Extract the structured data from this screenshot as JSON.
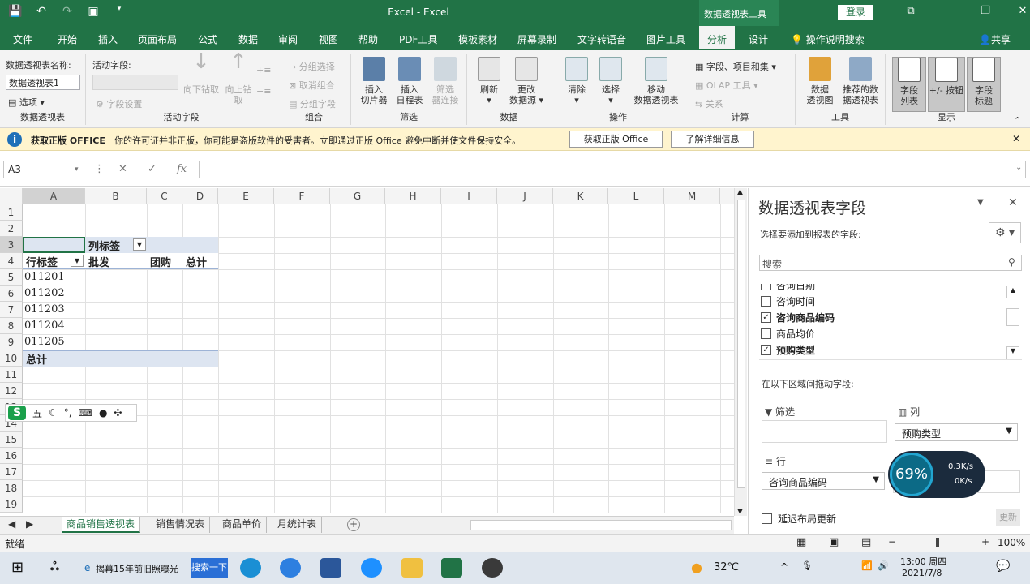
{
  "window": {
    "title": "Excel - Excel",
    "context_tools": "数据透视表工具",
    "login": "登录"
  },
  "icons": {
    "save": "save-icon",
    "undo": "undo-icon",
    "redo": "redo-icon",
    "touch": "touch-mode-icon",
    "customize": "chevron-down-icon"
  },
  "tabs": [
    {
      "label": "文件"
    },
    {
      "label": "开始"
    },
    {
      "label": "插入"
    },
    {
      "label": "页面布局"
    },
    {
      "label": "公式"
    },
    {
      "label": "数据"
    },
    {
      "label": "审阅"
    },
    {
      "label": "视图"
    },
    {
      "label": "帮助"
    },
    {
      "label": "PDF工具"
    },
    {
      "label": "模板素材"
    },
    {
      "label": "屏幕录制"
    },
    {
      "label": "文字转语音"
    },
    {
      "label": "图片工具"
    },
    {
      "label": "分析"
    },
    {
      "label": "设计"
    }
  ],
  "tellme": "操作说明搜索",
  "share": "共享",
  "ribbon": {
    "pivot_name_label": "数据透视表名称:",
    "pivot_name_value": "数据透视表1",
    "options": "选项",
    "group_pivot": "数据透视表",
    "active_field_label": "活动字段:",
    "field_settings": "字段设置",
    "drill_down": "向下钻取",
    "drill_up": "向上钻取",
    "drill_up_line1": "向上钻",
    "drill_up_line2": "取",
    "group_active": "活动字段",
    "group_selection": "分组选择",
    "ungroup": "取消组合",
    "group_field": "分组字段",
    "group_group": "组合",
    "insert_slicer_1": "插入",
    "insert_slicer_2": "切片器",
    "insert_timeline_1": "插入",
    "insert_timeline_2": "日程表",
    "filter_conn_1": "筛选",
    "filter_conn_2": "器连接",
    "group_filter": "筛选",
    "refresh": "刷新",
    "change_src_1": "更改",
    "change_src_2": "数据源",
    "group_data": "数据",
    "clear": "清除",
    "select": "选择",
    "move_1": "移动",
    "move_2": "数据透视表",
    "group_actions": "操作",
    "fields_items": "字段、项目和集",
    "olap": "OLAP 工具",
    "relations": "关系",
    "group_calc": "计算",
    "pivot_chart_1": "数据",
    "pivot_chart_2": "透视图",
    "recommended_1": "推荐的数",
    "recommended_2": "据透视表",
    "group_tools": "工具",
    "field_list_1": "字段",
    "field_list_2": "列表",
    "buttons_1": "+/- 按钮",
    "headers_1": "字段",
    "headers_2": "标题",
    "group_show": "显示"
  },
  "notification": {
    "title": "获取正版 OFFICE",
    "message": "你的许可证并非正版，你可能是盗版软件的受害者。立即通过正版 Office 避免中断并使文件保持安全。",
    "btn_genuine": "获取正版 Office",
    "btn_more": "了解详细信息"
  },
  "formula_bar": {
    "name_box": "A3",
    "fx": "fx",
    "value": ""
  },
  "columns": [
    "A",
    "B",
    "C",
    "D",
    "E",
    "F",
    "G",
    "H",
    "I",
    "J",
    "K",
    "L",
    "M"
  ],
  "rows": [
    "1",
    "2",
    "3",
    "4",
    "5",
    "6",
    "7",
    "8",
    "9",
    "10",
    "11",
    "12",
    "13",
    "14",
    "15",
    "16",
    "17",
    "18",
    "19"
  ],
  "pivot": {
    "col_label": "列标签",
    "row_label": "行标签",
    "col_heads": [
      "批发",
      "团购",
      "总计"
    ],
    "items": [
      "011201",
      "011202",
      "011203",
      "011204",
      "011205"
    ],
    "total": "总计"
  },
  "ime": {
    "logo": "S",
    "mode": "五"
  },
  "sheets": [
    {
      "label": "商品销售透视表"
    },
    {
      "label": "销售情况表"
    },
    {
      "label": "商品单价"
    },
    {
      "label": "月统计表"
    }
  ],
  "status": {
    "ready": "就绪",
    "zoom": "100%"
  },
  "pane": {
    "title": "数据透视表字段",
    "subtitle": "选择要添加到报表的字段:",
    "search_placeholder": "搜索",
    "fields": [
      {
        "label": "咨询日期",
        "checked": false
      },
      {
        "label": "咨询时间",
        "checked": false
      },
      {
        "label": "咨询商品编码",
        "checked": true
      },
      {
        "label": "商品均价",
        "checked": false
      },
      {
        "label": "预购类型",
        "checked": true
      }
    ],
    "areas_label": "在以下区域间拖动字段:",
    "area_filter": "筛选",
    "area_columns": "列",
    "area_rows": "行",
    "col_field": "预购类型",
    "row_field": "咨询商品编码",
    "defer": "延迟布局更新",
    "update": "更新"
  },
  "speed": {
    "percent": "69%",
    "up": "0.3K/s",
    "down": "0K/s"
  },
  "taskbar": {
    "news": "揭幕15年前旧照曝光",
    "search": "搜索一下",
    "temp": "32℃",
    "time": "13:00 周四",
    "date": "2021/7/8"
  }
}
